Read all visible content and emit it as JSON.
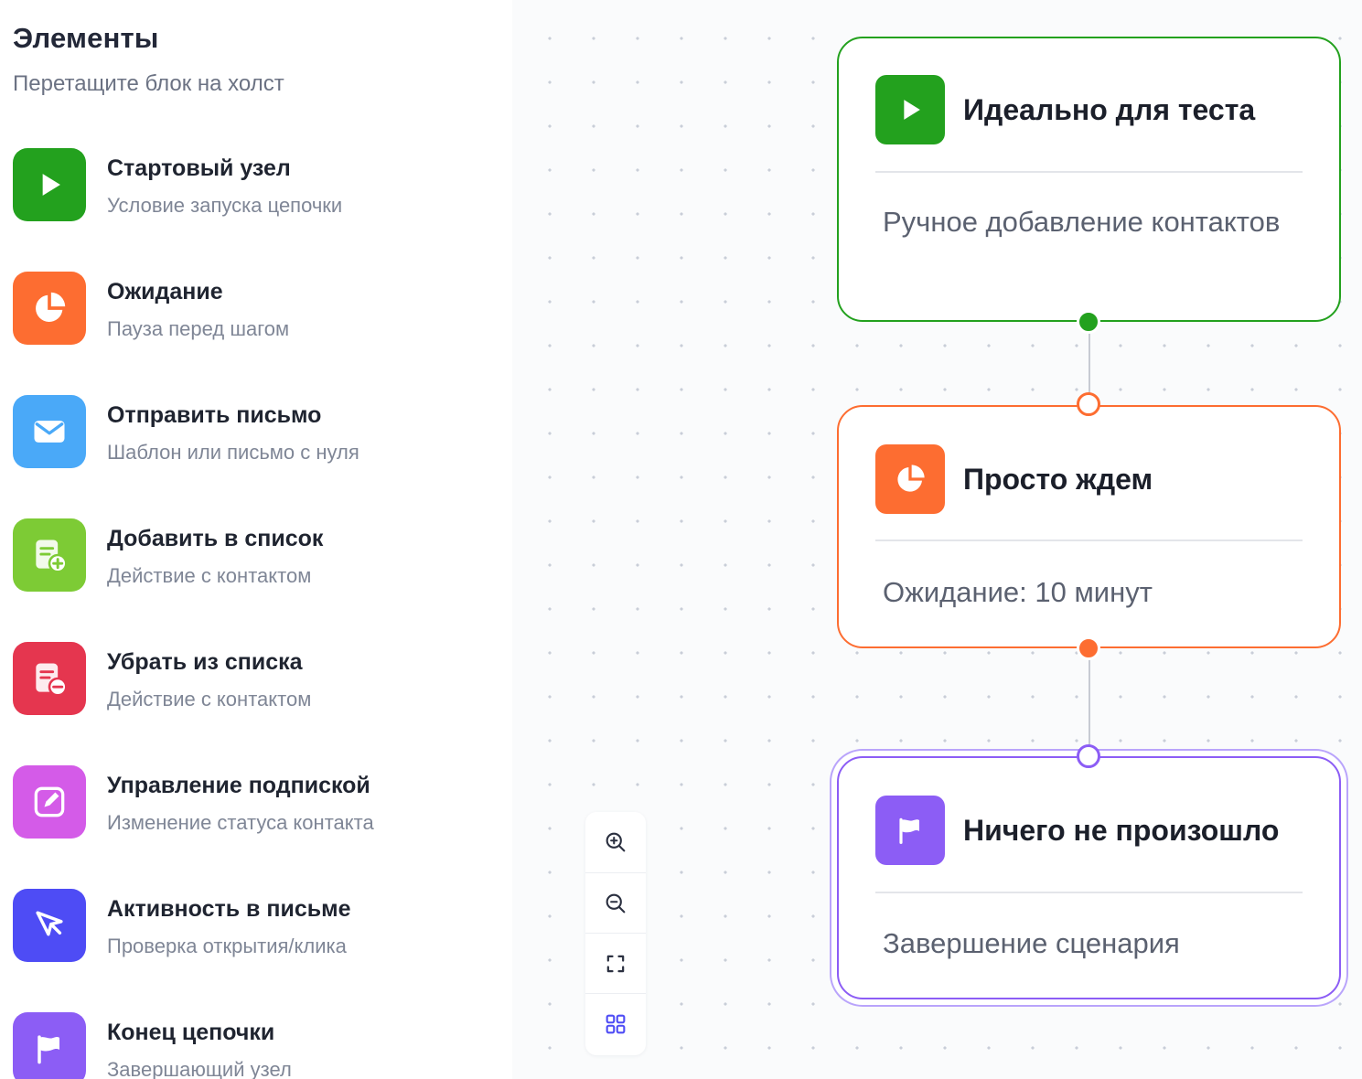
{
  "sidebar": {
    "title": "Элементы",
    "subtitle": "Перетащите блок на холст",
    "items": [
      {
        "label": "Стартовый узел",
        "desc": "Условие запуска цепочки",
        "icon": "play-icon",
        "color": "#23a11e"
      },
      {
        "label": "Ожидание",
        "desc": "Пауза перед шагом",
        "icon": "pie-clock-icon",
        "color": "#fd6d31"
      },
      {
        "label": "Отправить письмо",
        "desc": "Шаблон или письмо с нуля",
        "icon": "mail-icon",
        "color": "#4aa9f8"
      },
      {
        "label": "Добавить в список",
        "desc": "Действие с контактом",
        "icon": "list-add-icon",
        "color": "#7dcb35"
      },
      {
        "label": "Убрать из списка",
        "desc": "Действие с контактом",
        "icon": "list-remove-icon",
        "color": "#e5364f"
      },
      {
        "label": "Управление подпиской",
        "desc": "Изменение статуса контакта",
        "icon": "edit-icon",
        "color": "#d45be8"
      },
      {
        "label": "Активность в письме",
        "desc": "Проверка открытия/клика",
        "icon": "cursor-icon",
        "color": "#4e4cf5"
      },
      {
        "label": "Конец цепочки",
        "desc": "Завершающий узел",
        "icon": "flag-icon",
        "color": "#8c5df5"
      }
    ]
  },
  "canvas": {
    "nodes": [
      {
        "title": "Идеально для теста",
        "body": "Ручное добавление контактов",
        "icon": "play-icon",
        "color": "#23a11e"
      },
      {
        "title": "Просто ждем",
        "body": "Ожидание: 10 минут",
        "icon": "pie-clock-icon",
        "color": "#fd6d31"
      },
      {
        "title": "Ничего не произошло",
        "body": "Завершение сценария",
        "icon": "flag-icon",
        "color": "#8c5df5",
        "selected": true
      }
    ]
  },
  "controls": {
    "items": [
      "zoom-in-icon",
      "zoom-out-icon",
      "fit-view-icon",
      "grid-icon"
    ]
  }
}
